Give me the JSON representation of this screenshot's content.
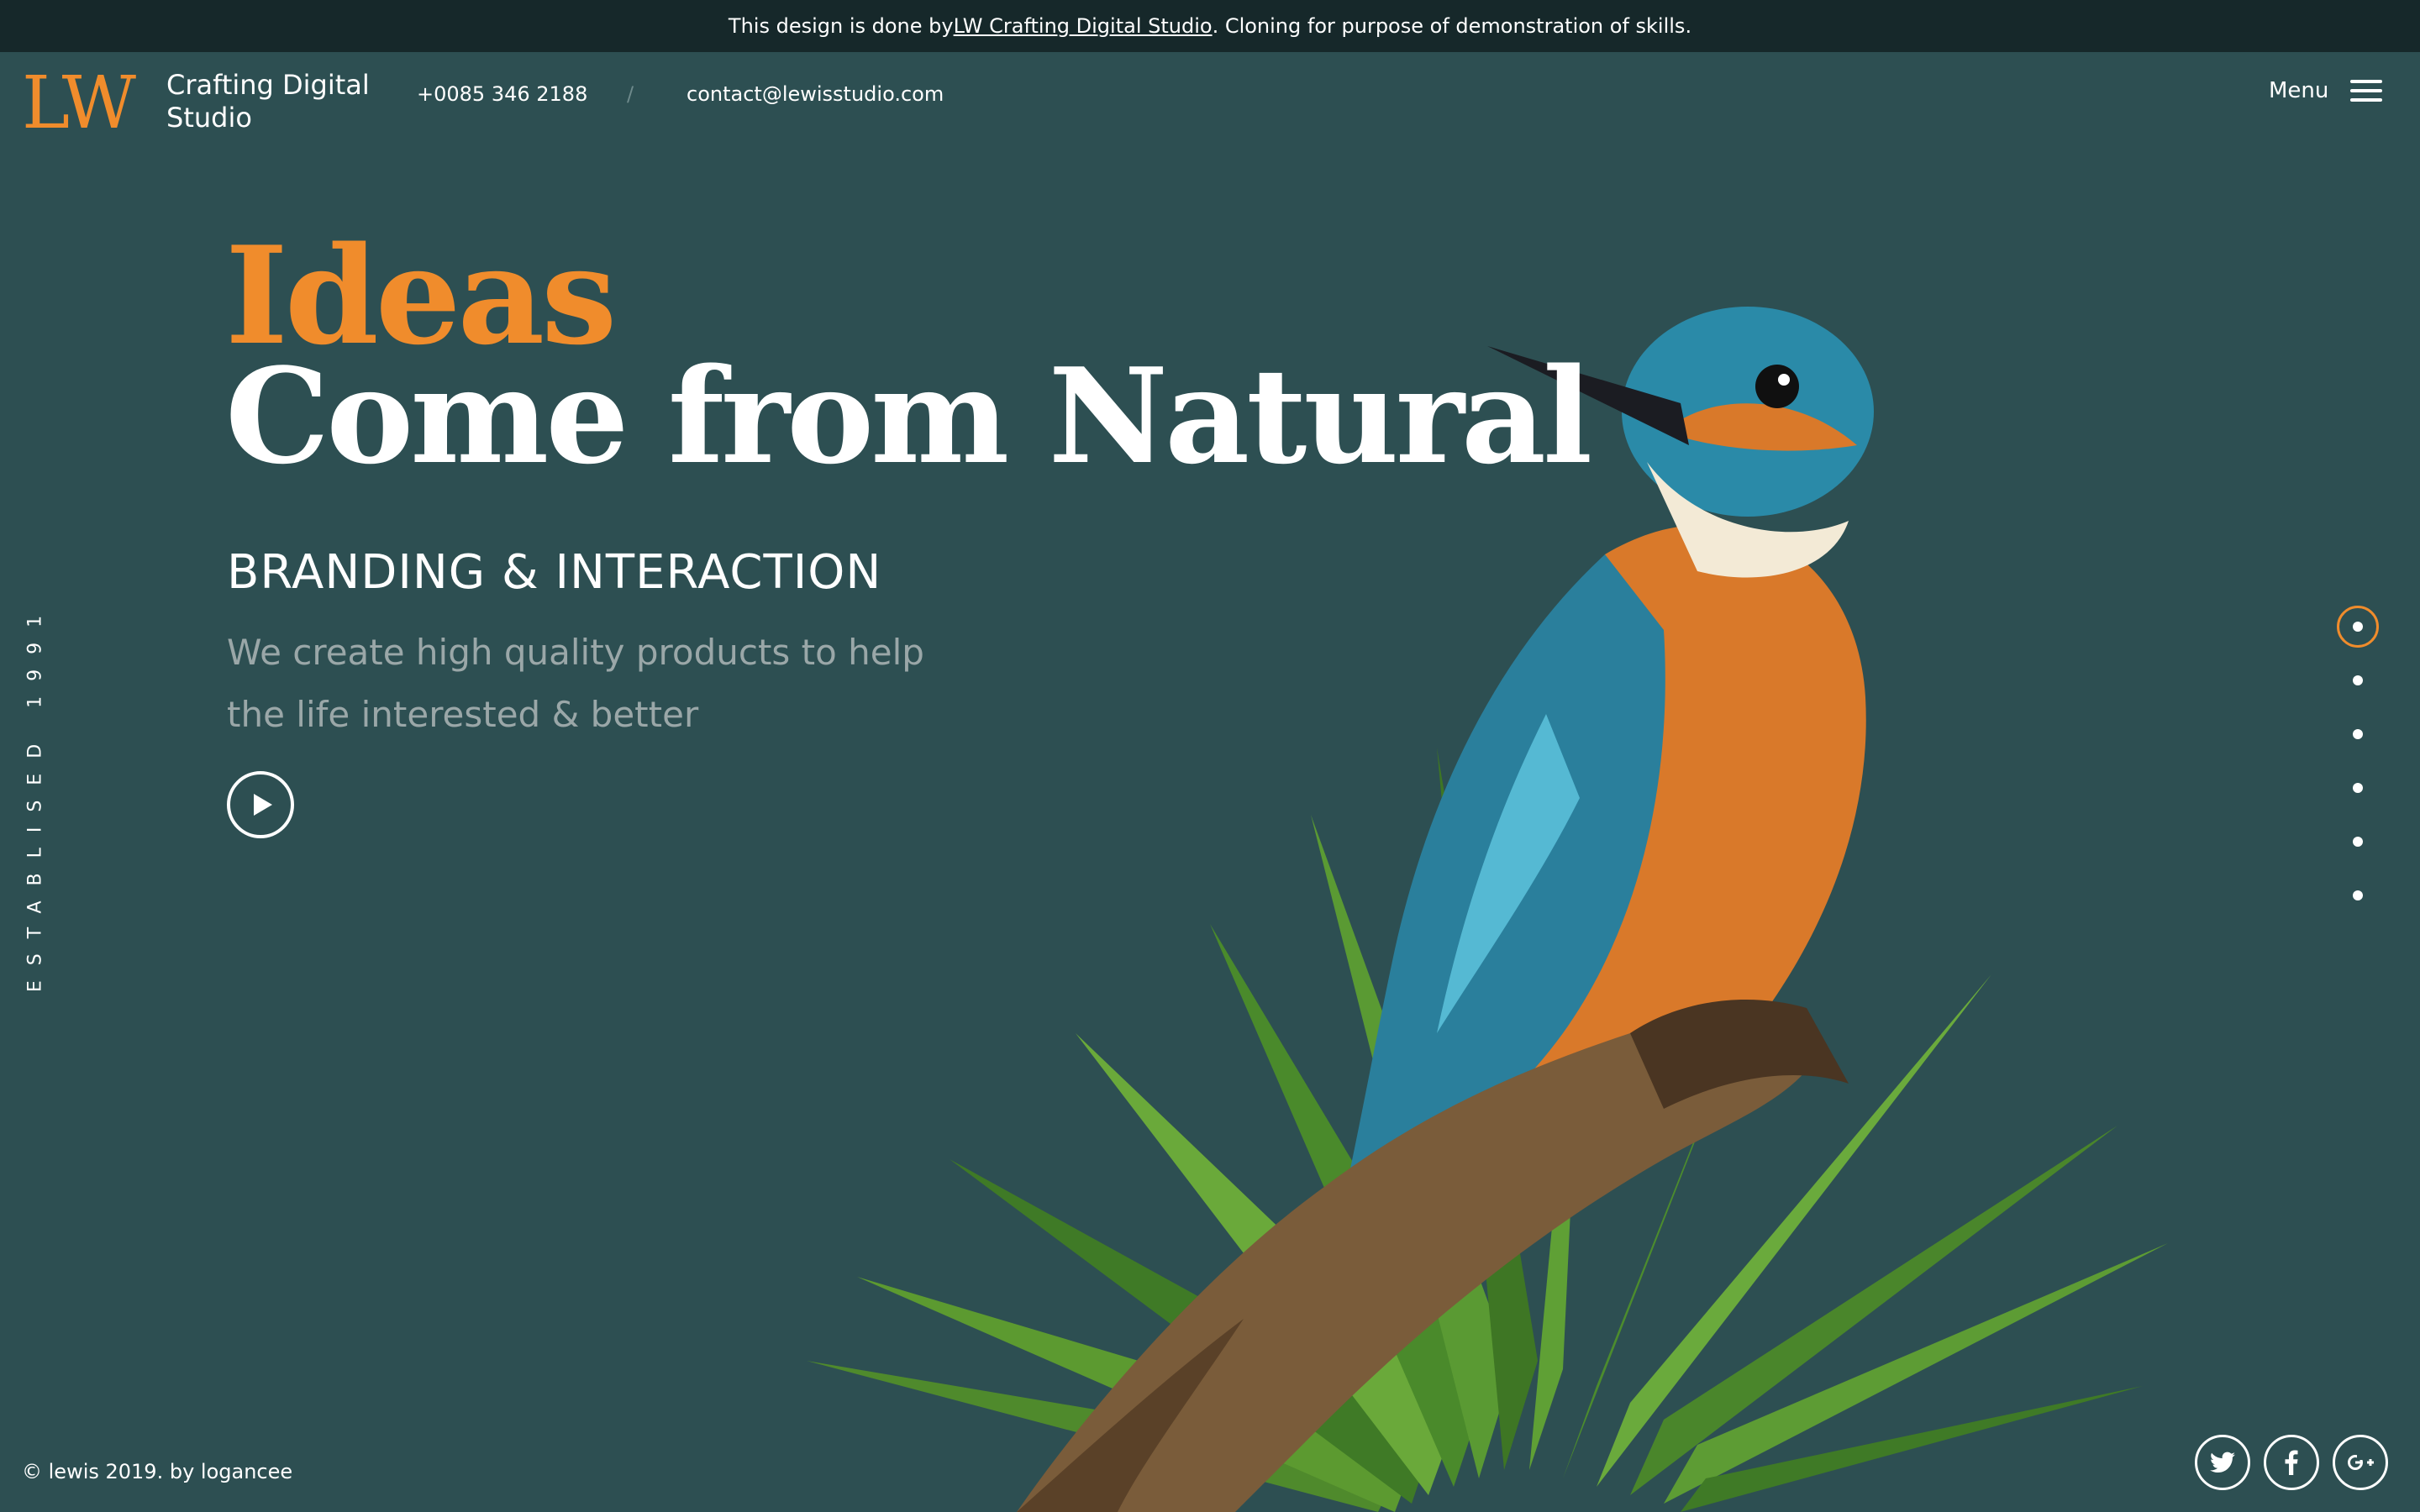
{
  "notice": {
    "prefix": "This design is done by ",
    "link": "LW Crafting Digital Studio",
    "suffix": ". Cloning for purpose of demonstration of skills."
  },
  "header": {
    "logo": "LW",
    "studio_name": "Crafting Digital Studio",
    "phone": "+0085 346 2188",
    "divider": "/",
    "email": "contact@lewisstudio.com",
    "menu_label": "Menu"
  },
  "hero": {
    "title_accent": "Ideas",
    "title_main": "Come from Natural",
    "subtitle": "BRANDING & INTERACTION",
    "description": "We create high quality products to help the life interested & better"
  },
  "established": "ESTABLISED 1991",
  "slides": {
    "count": 6,
    "active_index": 0
  },
  "footer": {
    "copyright": "© lewis 2019.  by logancee",
    "social": [
      {
        "icon": "twitter-icon"
      },
      {
        "icon": "facebook-icon"
      },
      {
        "icon": "google-plus-icon"
      }
    ]
  },
  "colors": {
    "background": "#2d4f52",
    "notice_bar": "#16282a",
    "accent": "#f08c2c",
    "text": "#ffffff",
    "muted": "#9aa7a8"
  }
}
